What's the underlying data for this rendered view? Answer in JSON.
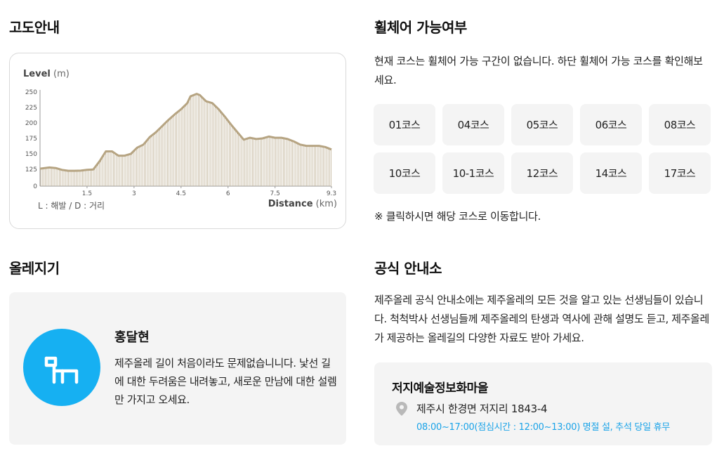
{
  "altitude": {
    "title": "고도안내",
    "level_label": "Level",
    "level_unit": "(m)",
    "distance_label": "Distance",
    "distance_unit": "(km)",
    "legend_note": "L : 해발 / D : 거리",
    "chart_data": {
      "type": "area",
      "xlabel": "Distance (km)",
      "ylabel": "Level (m)",
      "x_ticks": [
        "1.5",
        "3",
        "4.5",
        "6",
        "7.5",
        "9.3"
      ],
      "y_ticks": [
        "0",
        "125",
        "150",
        "175",
        "200",
        "225",
        "250"
      ],
      "xlim": [
        0,
        9.3
      ],
      "ylim": [
        0,
        250
      ],
      "fill_color": "#c2b49a",
      "line_color": "#b6a482",
      "x": [
        0,
        0.3,
        0.5,
        0.7,
        0.9,
        1.1,
        1.3,
        1.5,
        1.7,
        1.9,
        2.1,
        2.3,
        2.5,
        2.7,
        2.9,
        3.1,
        3.3,
        3.5,
        3.7,
        3.9,
        4.1,
        4.3,
        4.5,
        4.7,
        4.8,
        5.0,
        5.1,
        5.2,
        5.3,
        5.5,
        5.7,
        5.9,
        6.1,
        6.3,
        6.5,
        6.7,
        6.9,
        7.1,
        7.3,
        7.5,
        7.7,
        7.9,
        8.1,
        8.3,
        8.5,
        8.7,
        8.9,
        9.1,
        9.3
      ],
      "y": [
        126,
        128,
        127,
        121,
        114,
        114,
        115,
        121,
        124,
        138,
        154,
        154,
        147,
        147,
        150,
        160,
        165,
        177,
        185,
        195,
        205,
        214,
        222,
        232,
        243,
        247,
        245,
        240,
        235,
        232,
        222,
        210,
        197,
        185,
        173,
        176,
        174,
        175,
        178,
        176,
        176,
        174,
        170,
        165,
        163,
        163,
        163,
        161,
        157
      ]
    }
  },
  "wheelchair": {
    "title": "휠체어 가능여부",
    "description": "현재 코스는 휠체어 가능 구간이 없습니다. 하단 휠체어 가능 코스를 확인해보세요.",
    "courses": [
      "01코스",
      "04코스",
      "05코스",
      "06코스",
      "08코스",
      "10코스",
      "10-1코스",
      "12코스",
      "14코스",
      "17코스"
    ],
    "note": "※ 클릭하시면 해당 코스로 이동합니다."
  },
  "guide": {
    "title": "올레지기",
    "name": "홍달현",
    "message": "제주올레 길이 처음이라도 문제없습니니다. 낯선 길에 대한 두려움은 내려놓고, 새로운 만남에 대한 설렘만 가지고 오세요.",
    "avatar_icon": "olle-horse-icon",
    "avatar_color": "#16b0f2"
  },
  "info_center": {
    "title": "공식 안내소",
    "description": "제주올레 공식 안내소에는 제주올레의 모든 것을 알고 있는 선생님들이 있습니다. 척척박사 선생님들께 제주올레의 탄생과 역사에 관해 설명도 듣고, 제주올레가 제공하는 올레길의 다양한 자료도 받아 가세요.",
    "name": "저지예술정보화마을",
    "address": "제주시 한경면 저지리 1843-4",
    "hours": "08:00~17:00(점심시간 : 12:00~13:00) 명절 설, 추석 당일 휴무",
    "hours_color": "#1aa3e8",
    "pin_icon": "location-pin-icon"
  }
}
